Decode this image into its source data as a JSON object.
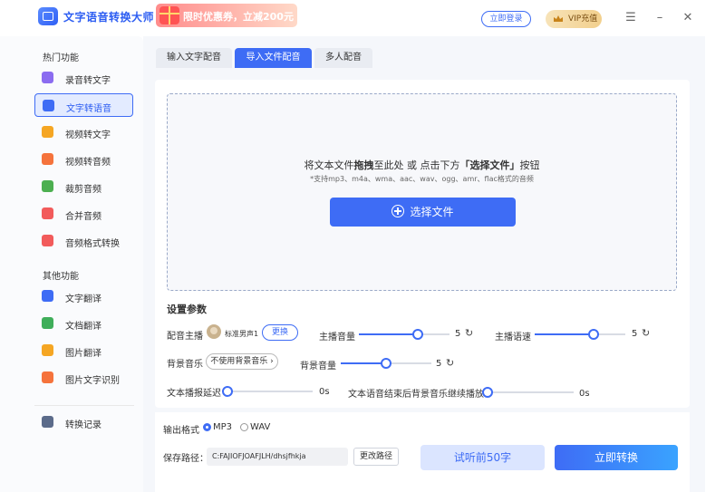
{
  "app": {
    "title": "文字语音转换大师",
    "promo_text": "限时优惠券，立减200元",
    "login_label": "立即登录",
    "vip_label": "VIP充值"
  },
  "sidebar": {
    "section1_title": "热门功能",
    "section2_title": "其他功能",
    "items": [
      {
        "label": "录音转文字",
        "icon": "microphone-icon",
        "color": "#8b6cf0"
      },
      {
        "label": "文字转语音",
        "icon": "text-icon",
        "color": "#3e6cf5"
      },
      {
        "label": "视频转文字",
        "icon": "video-icon",
        "color": "#f5a623"
      },
      {
        "label": "视频转音频",
        "icon": "video-play-icon",
        "color": "#f5733c"
      },
      {
        "label": "裁剪音频",
        "icon": "crop-icon",
        "color": "#4caf50"
      },
      {
        "label": "合并音频",
        "icon": "merge-icon",
        "color": "#f25b5b"
      },
      {
        "label": "音频格式转换",
        "icon": "convert-icon",
        "color": "#f25b5b"
      },
      {
        "label": "文字翻译",
        "icon": "word-icon",
        "color": "#3e6cf5"
      },
      {
        "label": "文档翻译",
        "icon": "excel-icon",
        "color": "#3fae5a"
      },
      {
        "label": "图片翻译",
        "icon": "image-icon",
        "color": "#f5a623"
      },
      {
        "label": "图片文字识别",
        "icon": "image-ocr-icon",
        "color": "#f5733c"
      },
      {
        "label": "转换记录",
        "icon": "history-icon",
        "color": "#5b6b8a"
      }
    ]
  },
  "tabs": [
    "输入文字配音",
    "导入文件配音",
    "多人配音"
  ],
  "dropzone": {
    "text_before": "将文本文件",
    "text_bold1": "拖拽",
    "text_middle": "至此处 或 点击下方",
    "text_bold2": "「选择文件」",
    "text_after": "按钮",
    "sub": "*支持mp3、m4a、wma、aac、wav、ogg、amr、flac格式的音频",
    "button": "选择文件"
  },
  "settings": {
    "title": "设置参数",
    "voice_label": "配音主播",
    "voice_name": "标准男声1",
    "change_btn": "更换",
    "volume_label": "主播音量",
    "volume_value": "5",
    "volume_fraction": 0.65,
    "speed_label": "主播语速",
    "speed_value": "5",
    "speed_fraction": 0.65,
    "bgm_label": "背景音乐",
    "bgm_btn": "不使用背景音乐",
    "bgm_volume_label": "背景音量",
    "bgm_volume_value": "5",
    "bgm_volume_fraction": 0.5,
    "delay_label": "文本播报延迟",
    "delay_value": "0s",
    "delay_fraction": 0,
    "continue_label": "文本语音结束后背景音乐继续播放",
    "continue_value": "0s",
    "continue_fraction": 0
  },
  "output": {
    "format_label": "输出格式",
    "formats": [
      "MP3",
      "WAV"
    ],
    "selected": "MP3",
    "path_label": "保存路径：",
    "path_value": "C:FAJIOFJOAFJLH/dhsjfhkja",
    "change_path_btn": "更改路径",
    "preview_btn": "试听前50字",
    "convert_btn": "立即转换"
  }
}
